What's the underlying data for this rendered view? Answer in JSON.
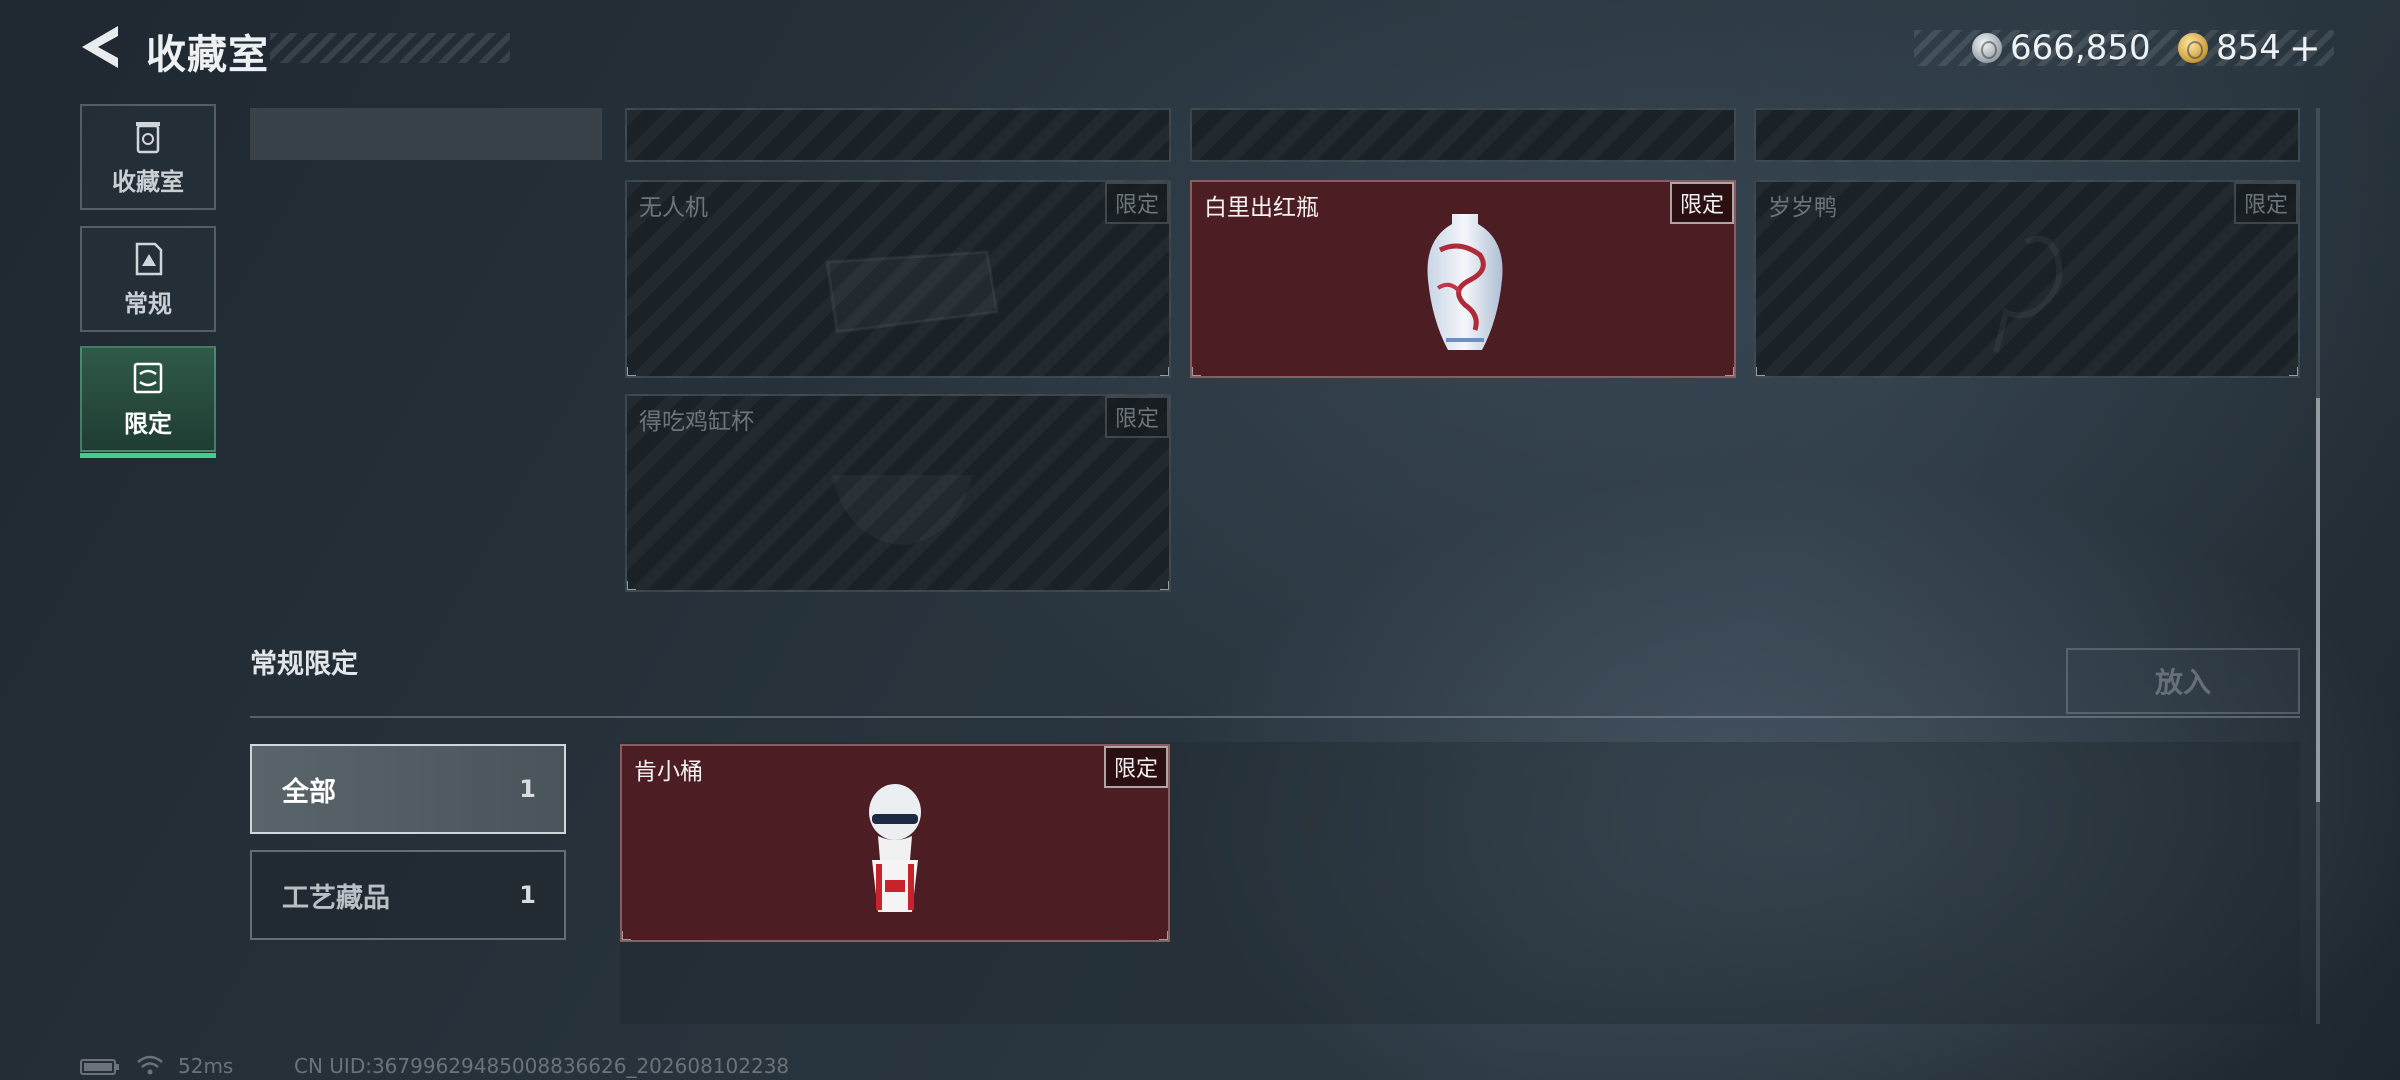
{
  "header": {
    "title": "收藏室",
    "currencies": [
      {
        "icon": "silver-coin-icon",
        "value": "666,850"
      },
      {
        "icon": "gold-coin-icon",
        "value": "854"
      }
    ],
    "add_symbol": "+"
  },
  "sidebar": {
    "tabs": [
      {
        "label": "收藏室",
        "icon": "trash-bin-icon",
        "active": false
      },
      {
        "label": "常规",
        "icon": "document-icon",
        "active": false
      },
      {
        "label": "限定",
        "icon": "limited-icon",
        "active": true
      }
    ]
  },
  "limited_section": {
    "items": [
      {
        "name": "无人机",
        "badge": "限定",
        "owned": false
      },
      {
        "name": "白里出红瓶",
        "badge": "限定",
        "owned": true
      },
      {
        "name": "岁岁鸭",
        "badge": "限定",
        "owned": false
      },
      {
        "name": "得吃鸡缸杯",
        "badge": "限定",
        "owned": false
      }
    ]
  },
  "regular_limited": {
    "title": "常规限定",
    "place_button": "放入",
    "filters": [
      {
        "label": "全部",
        "count": "1",
        "active": true
      },
      {
        "label": "工艺藏品",
        "count": "1",
        "active": false
      }
    ],
    "items": [
      {
        "name": "肯小桶",
        "badge": "限定",
        "owned": true
      }
    ]
  },
  "status_bar": {
    "ping": "52ms",
    "uid": "CN UID:3679962948500883662​6_202608102238"
  },
  "colors": {
    "accent_green": "#3fd08f",
    "owned_card": "#4c1d22"
  }
}
